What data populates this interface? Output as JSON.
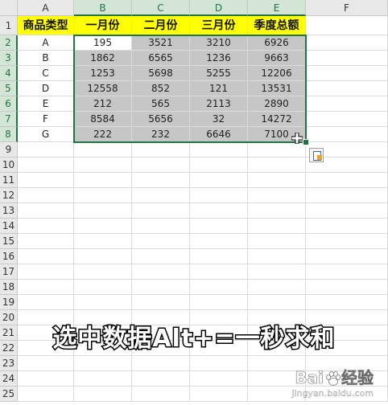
{
  "columns": [
    "A",
    "B",
    "C",
    "D",
    "E",
    "F"
  ],
  "rows": [
    "1",
    "2",
    "3",
    "4",
    "5",
    "6",
    "7",
    "8",
    "9",
    "10",
    "11",
    "12",
    "13",
    "14",
    "15",
    "16",
    "17",
    "18",
    "19",
    "20",
    "21",
    "22",
    "23",
    "24",
    "25"
  ],
  "table": {
    "headers": [
      "商品类型",
      "一月份",
      "二月份",
      "三月份",
      "季度总额"
    ],
    "data": [
      [
        "A",
        "195",
        "3521",
        "3210",
        "6926"
      ],
      [
        "B",
        "1862",
        "6565",
        "1236",
        "9663"
      ],
      [
        "C",
        "1253",
        "5698",
        "5255",
        "12206"
      ],
      [
        "D",
        "12558",
        "852",
        "121",
        "13531"
      ],
      [
        "E",
        "212",
        "565",
        "2113",
        "2890"
      ],
      [
        "F",
        "8584",
        "5656",
        "32",
        "14272"
      ],
      [
        "G",
        "222",
        "232",
        "6646",
        "7100"
      ]
    ]
  },
  "caption": "选中数据Alt+=一秒求和",
  "watermark": {
    "logo_left": "Bai",
    "logo_right": "经验",
    "url": "jingyan.baidu.com"
  },
  "colors": {
    "header_fill": "#ffff00",
    "selection_fill": "#c6c6c6",
    "selection_border": "#217346"
  },
  "icons": {
    "quick_analysis": "quick-analysis-icon",
    "cursor": "crosshair-cursor-icon"
  }
}
